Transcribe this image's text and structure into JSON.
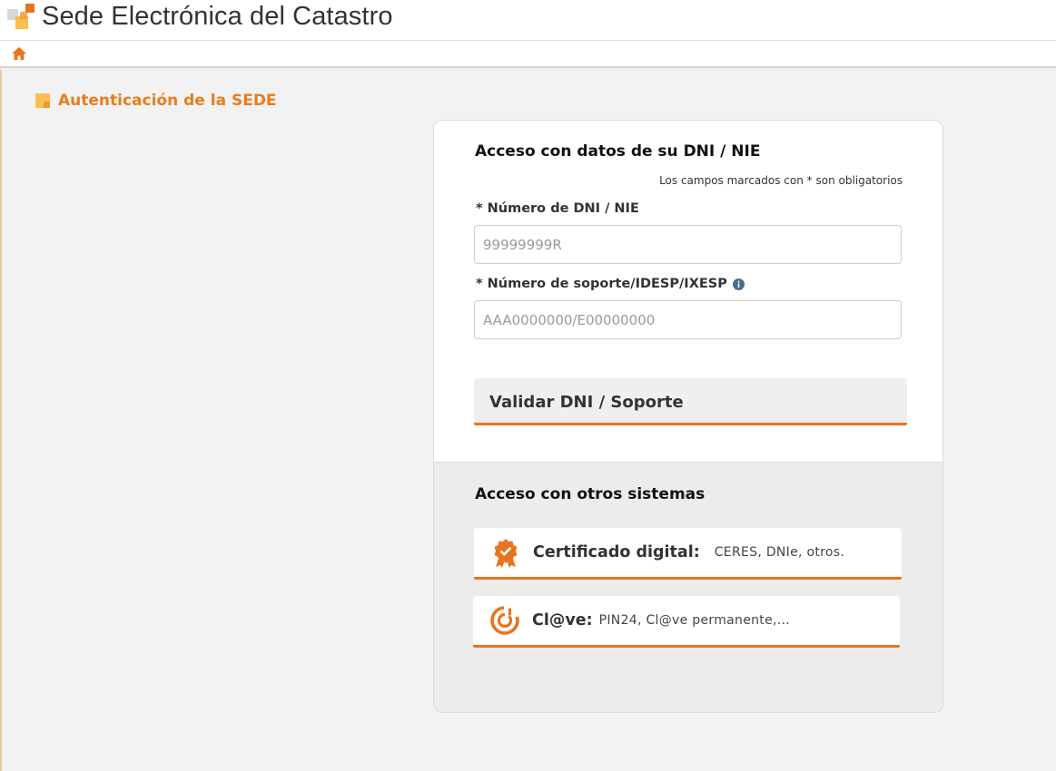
{
  "header": {
    "site_title": "Sede Electrónica del Catastro",
    "logo_icon": "catastro-logo-icon"
  },
  "navbar": {
    "home_icon": "home-icon"
  },
  "page": {
    "title": "Autenticación de la SEDE"
  },
  "dni_access": {
    "heading": "Acceso con datos de su DNI / NIE",
    "required_note": "Los campos marcados con * son obligatorios",
    "dni_label": "* Número de DNI / NIE",
    "dni_placeholder": "99999999R",
    "dni_value": "",
    "support_label": "* Número de soporte/IDESP/IXESP",
    "support_placeholder": "AAA0000000/E00000000",
    "support_value": "",
    "validate_button": "Validar DNI / Soporte"
  },
  "other_access": {
    "heading": "Acceso con otros sistemas",
    "options": [
      {
        "label": "Certificado digital:",
        "detail": "CERES, DNIe, otros.",
        "icon": "certificate-badge-icon"
      },
      {
        "label": "Cl@ve:",
        "detail": "PIN24, Cl@ve permanente,...",
        "icon": "clave-icon"
      }
    ]
  },
  "colors": {
    "accent": "#e8741e",
    "background": "#f3f2f2",
    "title_orange": "#e87d1e"
  }
}
